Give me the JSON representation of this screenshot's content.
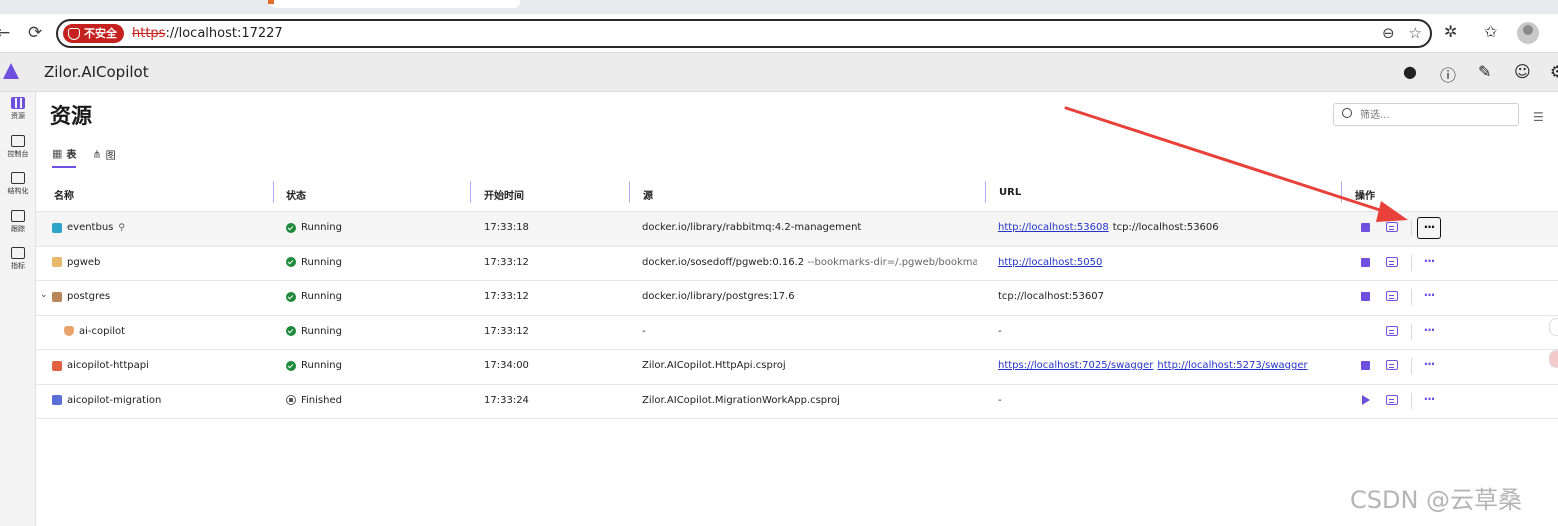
{
  "browser": {
    "security_label": "不安全",
    "url_scheme": "https",
    "url_rest": "://localhost:17227"
  },
  "app": {
    "title": "Zilor.AICopilot"
  },
  "rail": [
    {
      "label": "资源"
    },
    {
      "label": "控制台"
    },
    {
      "label": "结构化"
    },
    {
      "label": "跟踪"
    },
    {
      "label": "指标"
    }
  ],
  "page": {
    "title": "资源",
    "filter_placeholder": "筛选...",
    "tabs": [
      {
        "label": "表"
      },
      {
        "label": "图"
      }
    ]
  },
  "table": {
    "headers": {
      "name": "名称",
      "state": "状态",
      "start": "开始时间",
      "source": "源",
      "url": "URL",
      "actions": "操作"
    },
    "rows": [
      {
        "name": "eventbus",
        "state": "Running",
        "start": "17:33:18",
        "source": "docker.io/library/rabbitmq:4.2-management",
        "source_extra": "",
        "urls": [
          "http://localhost:53608"
        ],
        "plain_urls": [
          "tcp://localhost:53606"
        ]
      },
      {
        "name": "pgweb",
        "state": "Running",
        "start": "17:33:12",
        "source": "docker.io/sosedoff/pgweb:0.16.2",
        "source_extra": "--bookmarks-dir=/.pgweb/bookmar...",
        "urls": [
          "http://localhost:5050"
        ],
        "plain_urls": []
      },
      {
        "name": "postgres",
        "state": "Running",
        "start": "17:33:12",
        "source": "docker.io/library/postgres:17.6",
        "source_extra": "",
        "urls": [],
        "plain_urls": [
          "tcp://localhost:53607"
        ]
      },
      {
        "name": "ai-copilot",
        "state": "Running",
        "start": "17:33:12",
        "source": "-",
        "source_extra": "",
        "urls": [],
        "plain_urls": [
          "-"
        ]
      },
      {
        "name": "aicopilot-httpapi",
        "state": "Running",
        "start": "17:34:00",
        "source": "Zilor.AICopilot.HttpApi.csproj",
        "source_extra": "",
        "urls": [
          "https://localhost:7025/swagger",
          "http://localhost:5273/swagger"
        ],
        "plain_urls": []
      },
      {
        "name": "aicopilot-migration",
        "state": "Finished",
        "start": "17:33:24",
        "source": "Zilor.AICopilot.MigrationWorkApp.csproj",
        "source_extra": "",
        "urls": [],
        "plain_urls": [
          "-"
        ]
      }
    ],
    "more_label": "···"
  },
  "watermark": "CSDN @云草桑",
  "colors": {
    "accent": "#6f4fe0",
    "running": "#1e8a3a",
    "insecure": "#c5221f",
    "annotation_arrow": "#e8413a"
  }
}
